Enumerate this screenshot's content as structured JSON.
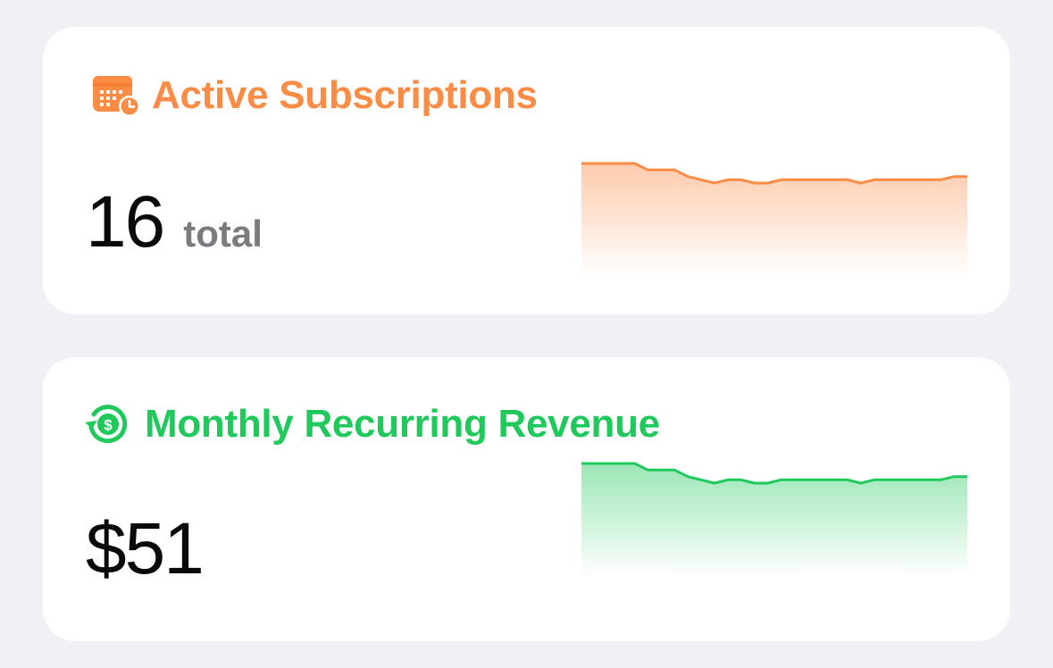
{
  "cards": [
    {
      "title": "Active Subscriptions",
      "icon": "calendar-clock-icon",
      "value": "16",
      "unit": "total",
      "color": "#fa8c46",
      "sparkline": [
        20,
        20,
        20,
        20,
        20,
        18,
        18,
        18,
        16,
        15,
        14,
        15,
        15,
        14,
        14,
        15,
        15,
        15,
        15,
        15,
        15,
        14,
        15,
        15,
        15,
        15,
        15,
        15,
        16,
        16
      ]
    },
    {
      "title": "Monthly Recurring Revenue",
      "icon": "recurring-dollar-icon",
      "value": "$51",
      "unit": "",
      "color": "#20c95c",
      "sparkline": [
        20,
        20,
        20,
        20,
        20,
        18,
        18,
        18,
        16,
        15,
        14,
        15,
        15,
        14,
        14,
        15,
        15,
        15,
        15,
        15,
        15,
        14,
        15,
        15,
        15,
        15,
        15,
        15,
        16,
        16
      ]
    }
  ]
}
